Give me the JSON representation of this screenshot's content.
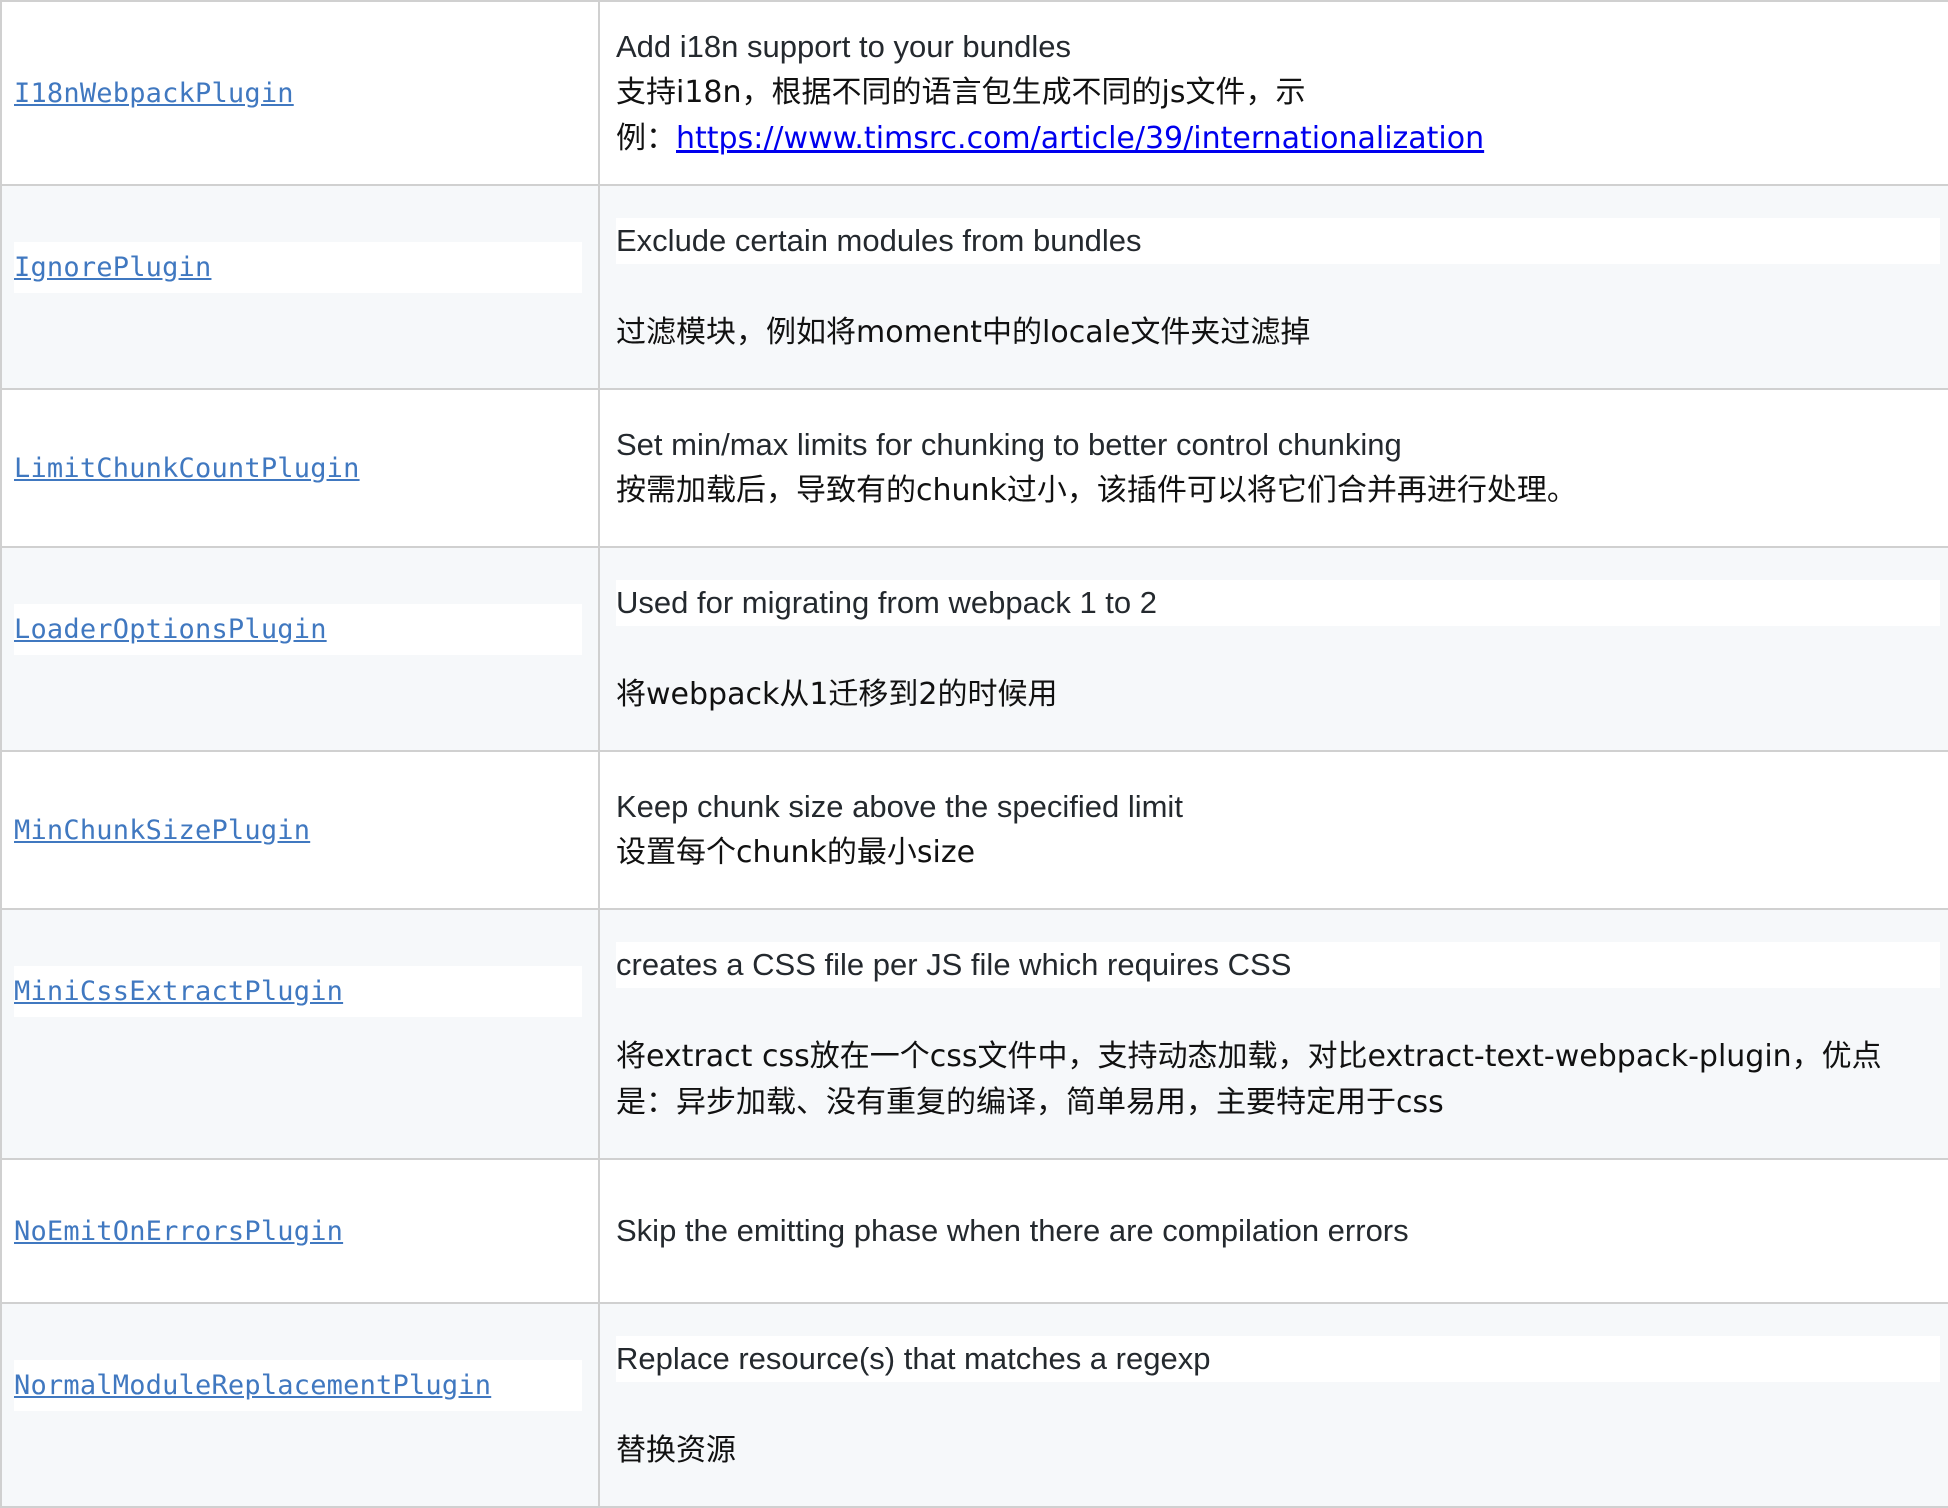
{
  "rows": [
    {
      "name": "I18nWebpackPlugin",
      "desc_en": "Add i18n support to your bundles",
      "desc_zh_1": "支持i18n，根据不同的语言包生成不同的js文件，示",
      "desc_zh_2": "例：",
      "link": "https://www.timsrc.com/article/39/internationalization"
    },
    {
      "name": "IgnorePlugin",
      "desc_en": "Exclude certain modules from bundles",
      "desc_zh": "过滤模块，例如将moment中的locale文件夹过滤掉"
    },
    {
      "name": "LimitChunkCountPlugin",
      "desc_en": "Set min/max limits for chunking to better control chunking",
      "desc_zh": "按需加载后，导致有的chunk过小，该插件可以将它们合并再进行处理。"
    },
    {
      "name": "LoaderOptionsPlugin",
      "desc_en": "Used for migrating from webpack 1 to 2",
      "desc_zh": "将webpack从1迁移到2的时候用"
    },
    {
      "name": "MinChunkSizePlugin",
      "desc_en": "Keep chunk size above the specified limit",
      "desc_zh": "设置每个chunk的最小size"
    },
    {
      "name": "MiniCssExtractPlugin",
      "desc_en": "creates a CSS file per JS file which requires CSS",
      "desc_zh_1": "将extract css放在一个css文件中，支持动态加载，对比extract-text-webpack-plugin，优点",
      "desc_zh_2": "是：异步加载、没有重复的编译，简单易用，主要特定用于css"
    },
    {
      "name": "NoEmitOnErrorsPlugin",
      "desc_en": "Skip the emitting phase when there are compilation errors"
    },
    {
      "name": "NormalModuleReplacementPlugin",
      "desc_en": "Replace resource(s) that matches a regexp",
      "desc_zh": "替换资源"
    }
  ]
}
